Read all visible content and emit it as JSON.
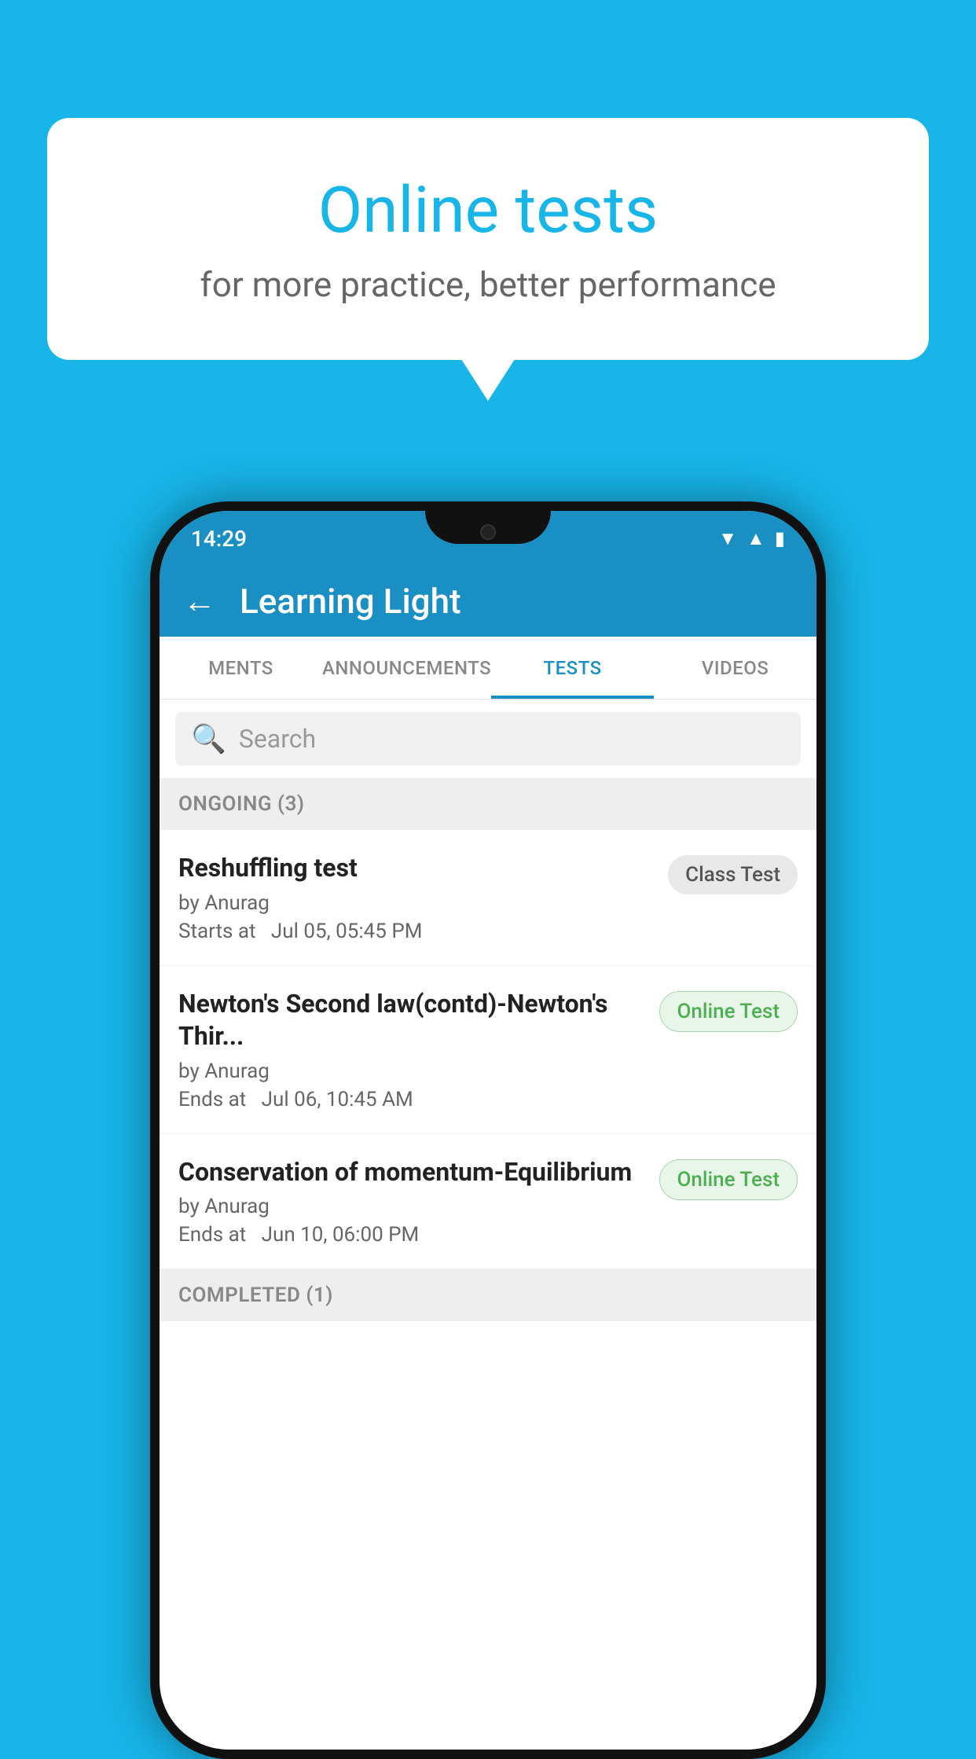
{
  "background_color": "#17b5e8",
  "speech_bubble": {
    "title": "Online tests",
    "subtitle": "for more practice, better performance"
  },
  "phone": {
    "status_bar": {
      "time": "14:29",
      "icons": [
        "wifi",
        "signal",
        "battery"
      ]
    },
    "app_header": {
      "title": "Learning Light",
      "back_label": "←"
    },
    "tabs": [
      {
        "label": "MENTS",
        "active": false
      },
      {
        "label": "ANNOUNCEMENTS",
        "active": false
      },
      {
        "label": "TESTS",
        "active": true
      },
      {
        "label": "VIDEOS",
        "active": false
      }
    ],
    "search": {
      "placeholder": "Search"
    },
    "ongoing_section": {
      "header": "ONGOING (3)",
      "tests": [
        {
          "name": "Reshuffling test",
          "author": "by Anurag",
          "time_label": "Starts at",
          "time": "Jul 05, 05:45 PM",
          "badge": "Class Test",
          "badge_type": "class"
        },
        {
          "name": "Newton's Second law(contd)-Newton's Thir...",
          "author": "by Anurag",
          "time_label": "Ends at",
          "time": "Jul 06, 10:45 AM",
          "badge": "Online Test",
          "badge_type": "online"
        },
        {
          "name": "Conservation of momentum-Equilibrium",
          "author": "by Anurag",
          "time_label": "Ends at",
          "time": "Jun 10, 06:00 PM",
          "badge": "Online Test",
          "badge_type": "online"
        }
      ]
    },
    "completed_section": {
      "header": "COMPLETED (1)"
    }
  }
}
